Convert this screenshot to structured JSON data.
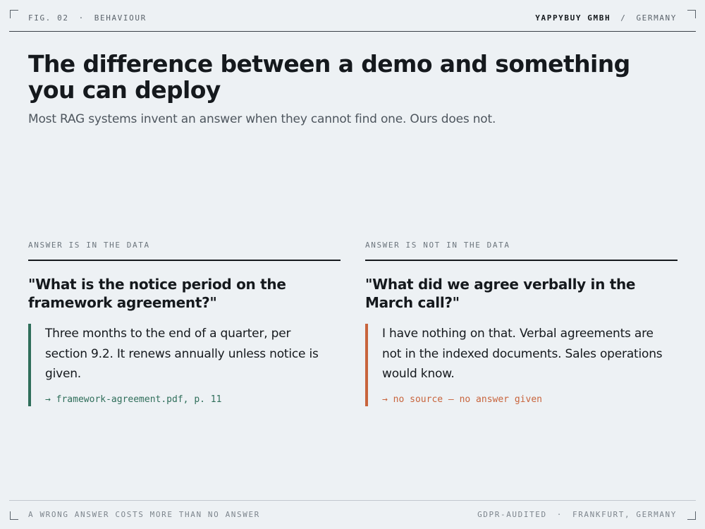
{
  "header": {
    "figure": "FIG. 02",
    "separator": "·",
    "section": "BEHAVIOUR",
    "company": "YAPPYBUY GMBH",
    "slash": "/",
    "country": "GERMANY"
  },
  "title": "The difference between a demo and something you can deploy",
  "subtitle": "Most RAG systems invent an answer when they cannot find one. Ours does not.",
  "columns": [
    {
      "label": "ANSWER IS IN THE DATA",
      "question": "\"What is the notice period on the framework agreement?\"",
      "answer": "Three months to the end of a quarter, per section 9.2. It renews annually unless notice is given.",
      "source": "→ framework-agreement.pdf, p. 11"
    },
    {
      "label": "ANSWER IS NOT IN THE DATA",
      "question": "\"What did we agree verbally in the March call?\"",
      "answer": "I have nothing on that. Verbal agreements are not in the indexed documents. Sales operations would know.",
      "source": "→ no source — no answer given"
    }
  ],
  "footer": {
    "tagline": "A WRONG ANSWER COSTS MORE THAN NO ANSWER",
    "audit": "GDPR-AUDITED",
    "separator": "·",
    "location": "FRANKFURT, GERMANY"
  },
  "colors": {
    "background": "#edf1f4",
    "ink": "#15191d",
    "found_accent": "#2f6e5a",
    "not_found_accent": "#c8643c"
  }
}
